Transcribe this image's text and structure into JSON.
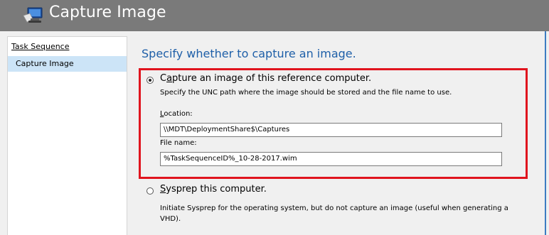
{
  "window": {
    "title": "Capture Image",
    "icon": "computer-wizard-icon"
  },
  "sidebar": {
    "items": [
      {
        "label": "Task Sequence",
        "selected": false
      },
      {
        "label": "Capture Image",
        "selected": true
      }
    ]
  },
  "main": {
    "heading": "Specify whether to capture an image.",
    "options": {
      "capture": {
        "label_prefix": "C",
        "label_accel": "a",
        "label_rest": "pture an image of this reference computer.",
        "selected": true,
        "description": "Specify the UNC path where the image should be stored and the file name to use."
      },
      "sysprep": {
        "label_accel": "S",
        "label_rest": "ysprep this computer.",
        "selected": false,
        "description": "Initiate Sysprep for the operating system, but do not capture an image (useful when generating a VHD)."
      }
    },
    "location": {
      "label_accel": "L",
      "label_rest": "ocation:",
      "value": "\\\\MDT\\DeploymentShare$\\Captures"
    },
    "file_name": {
      "label": "File name:",
      "value": "%TaskSequenceID%_10-28-2017.wim"
    }
  },
  "colors": {
    "header_bg": "#7a7a7a",
    "heading": "#1e5fa8",
    "highlight_box": "#e0141e",
    "selected_item_bg": "#cce4f7"
  }
}
